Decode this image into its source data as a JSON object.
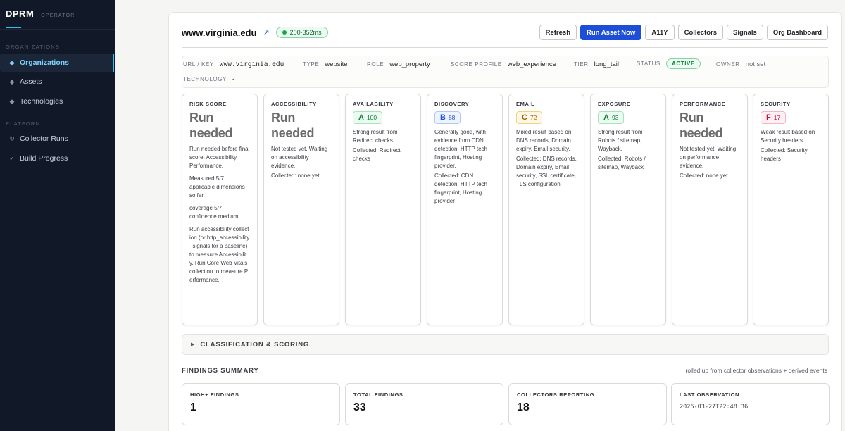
{
  "app": {
    "name": "DPRM",
    "subtitle": "OPERATOR"
  },
  "sidebar": {
    "sections": [
      {
        "label": "ORGANIZATIONS",
        "items": [
          {
            "label": "Organizations",
            "icon": "diamond-icon",
            "active": true
          },
          {
            "label": "Assets",
            "icon": "diamond-small-icon"
          },
          {
            "label": "Technologies",
            "icon": "diamond-small-icon"
          }
        ]
      },
      {
        "label": "PLATFORM",
        "items": [
          {
            "label": "Collector Runs",
            "icon": "refresh-icon"
          },
          {
            "label": "Build Progress",
            "icon": "check-icon"
          }
        ]
      }
    ]
  },
  "asset": {
    "title": "www.virginia.edu",
    "latency": "200·352ms"
  },
  "toolbar": {
    "buttons": [
      "Refresh",
      "Run Asset Now",
      "A11Y",
      "Collectors",
      "Signals",
      "Org Dashboard"
    ]
  },
  "meta": {
    "url_label": "URL / KEY",
    "url_value": "www.virginia.edu",
    "type_label": "TYPE",
    "type_value": "website",
    "role_label": "ROLE",
    "role_value": "web_property",
    "profile_label": "SCORE PROFILE",
    "profile_value": "web_experience",
    "tier_label": "TIER",
    "tier_value": "long_tail",
    "status_label": "STATUS",
    "status_value": "ACTIVE",
    "owner_label": "OWNER",
    "owner_value": "not set",
    "tech_label": "TECHNOLOGY",
    "tech_value": "-"
  },
  "scores": {
    "risk": {
      "label": "RISK SCORE",
      "big": "Run needed",
      "p1": "Run needed before final score: Accessibility, Performance.",
      "p2": "Measured 5/7 applicable dimensions so far.",
      "p3": "coverage 5/7 · confidence medium",
      "p4": "Run accessibility collection (or http_accessibility_signals for a baseline) to measure Accessibility. Run Core Web Vitals collection to measure Performance."
    },
    "accessibility": {
      "label": "ACCESSIBILITY",
      "big": "Run needed",
      "text": "Not tested yet. Waiting on accessibility evidence.",
      "collected": "Collected: none yet"
    },
    "availability": {
      "label": "AVAILABILITY",
      "grade": "A",
      "score": "100",
      "text": "Strong result from Redirect checks.",
      "collected": "Collected: Redirect checks"
    },
    "discovery": {
      "label": "DISCOVERY",
      "grade": "B",
      "score": "88",
      "text": "Generally good, with evidence from CDN detection, HTTP tech fingerprint, Hosting provider.",
      "collected": "Collected: CDN detection, HTTP tech fingerprint, Hosting provider"
    },
    "email": {
      "label": "EMAIL",
      "grade": "C",
      "score": "72",
      "text": "Mixed result based on DNS records, Domain expiry, Email security.",
      "collected": "Collected: DNS records, Domain expiry, Email security, SSL certificate, TLS configuration"
    },
    "exposure": {
      "label": "EXPOSURE",
      "grade": "A",
      "score": "93",
      "text": "Strong result from Robots / sitemap, Wayback.",
      "collected": "Collected: Robots / sitemap, Wayback"
    },
    "performance": {
      "label": "PERFORMANCE",
      "big": "Run needed",
      "text": "Not tested yet. Waiting on performance evidence.",
      "collected": "Collected: none yet"
    },
    "security": {
      "label": "SECURITY",
      "grade": "F",
      "score": "17",
      "text": "Weak result based on Security headers.",
      "collected": "Collected: Security headers"
    }
  },
  "classification": {
    "label": "CLASSIFICATION & SCORING"
  },
  "findings": {
    "title": "FINDINGS SUMMARY",
    "note": "rolled up from collector observations + derived events",
    "stats": [
      {
        "label": "HIGH+ FINDINGS",
        "value": "1"
      },
      {
        "label": "TOTAL FINDINGS",
        "value": "33"
      },
      {
        "label": "COLLECTORS REPORTING",
        "value": "18"
      },
      {
        "label": "LAST OBSERVATION",
        "value": "2026-03-27T22:48:36"
      }
    ]
  },
  "colors": {
    "accent": "#1d4ed8",
    "sidebar_bg": "#111827",
    "active_nav": "#38bdf8",
    "grade_a": "#15803d",
    "grade_b": "#1d4ed8",
    "grade_c": "#a16207",
    "grade_f": "#be123c"
  }
}
